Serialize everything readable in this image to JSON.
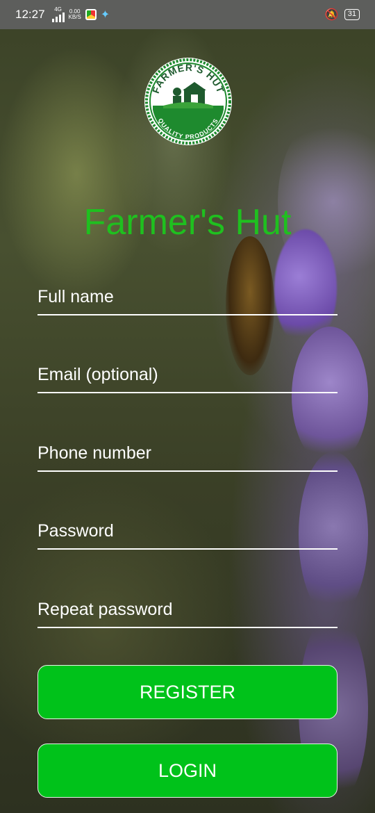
{
  "status_bar": {
    "time": "12:27",
    "network_type": "4G",
    "speed_value": "0.00",
    "speed_unit": "KB/S",
    "battery": "31"
  },
  "logo": {
    "top_text": "FARMER'S HUT",
    "bottom_text": "QUALITY PRODUCTS"
  },
  "app_title": "Farmer's Hut",
  "form": {
    "full_name_placeholder": "Full name",
    "email_placeholder": "Email (optional)",
    "phone_placeholder": "Phone number",
    "password_placeholder": "Password",
    "repeat_password_placeholder": "Repeat password"
  },
  "buttons": {
    "register": "REGISTER",
    "login": "LOGIN"
  },
  "colors": {
    "accent": "#00c21a",
    "title": "#1fc01f",
    "logo_green": "#1e8a2e"
  }
}
